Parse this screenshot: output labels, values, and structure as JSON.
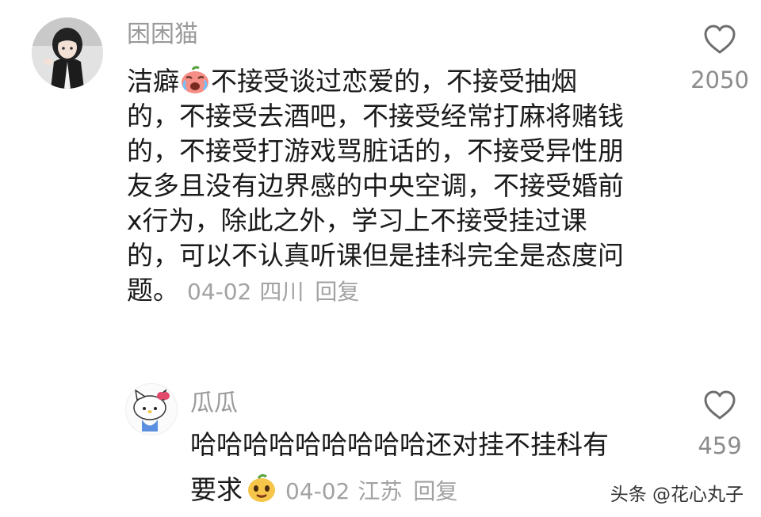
{
  "comment": {
    "username": "困困猫",
    "lines": [
      {
        "before": "洁癖",
        "after": "不接受谈过恋爱的，不接受抽烟"
      },
      "的，不接受去酒吧，不接受经常打麻将赌钱",
      "的，不接受打游戏骂脏话的，不接受异性朋",
      "友多且没有边界感的中央空调，不接受婚前",
      "x行为，除此之外，学习上不接受挂过课",
      "的，可以不认真听课但是挂科完全是态度问",
      "题。"
    ],
    "date": "04-02",
    "location": "四川",
    "reply_label": "回复",
    "like_count": "2050"
  },
  "reply": {
    "username": "瓜瓜",
    "lines": [
      "哈哈哈哈哈哈哈哈哈还对挂不挂科有",
      "要求"
    ],
    "date": "04-02",
    "location": "江苏",
    "reply_label": "回复",
    "like_count": "459"
  },
  "watermark": "头条 @花心丸子",
  "icons": {
    "like": "heart-outline-icon",
    "emoji_comment": "crying-emoji-icon",
    "emoji_reply": "smiling-emoji-icon"
  },
  "colors": {
    "text": "#1a1a1a",
    "meta": "#a2a2a2",
    "heart": "#6e6e6e"
  }
}
